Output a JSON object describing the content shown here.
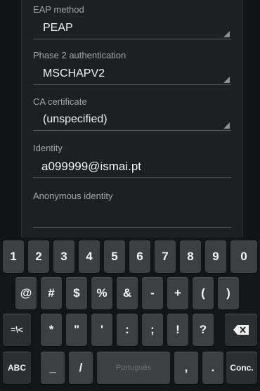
{
  "form": {
    "eap_method": {
      "label": "EAP method",
      "value": "PEAP"
    },
    "phase2": {
      "label": "Phase 2 authentication",
      "value": "MSCHAPV2"
    },
    "ca_cert": {
      "label": "CA certificate",
      "value": "(unspecified)"
    },
    "identity": {
      "label": "Identity",
      "value": "a099999@ismai.pt"
    },
    "anonymous_identity": {
      "label": "Anonymous identity",
      "value": ""
    }
  },
  "keyboard": {
    "row1": [
      "1",
      "2",
      "3",
      "4",
      "5",
      "6",
      "7",
      "8",
      "9",
      "0"
    ],
    "row2": [
      "@",
      "#",
      "$",
      "%",
      "&",
      "-",
      "+",
      "(",
      ")"
    ],
    "row3": {
      "shift": "=\\<",
      "keys": [
        "*",
        "\"",
        "'",
        ":",
        ";",
        "!",
        "?"
      ],
      "backspace_icon": "backspace-icon"
    },
    "row4": {
      "abc": "ABC",
      "underscore": "_",
      "slash": "/",
      "space": "Português",
      "comma": ",",
      "period": ".",
      "done": "Conc."
    }
  },
  "colors": {
    "dialog": "#1e1f21",
    "key": "#3d4043",
    "text": "#f3f3f3"
  }
}
